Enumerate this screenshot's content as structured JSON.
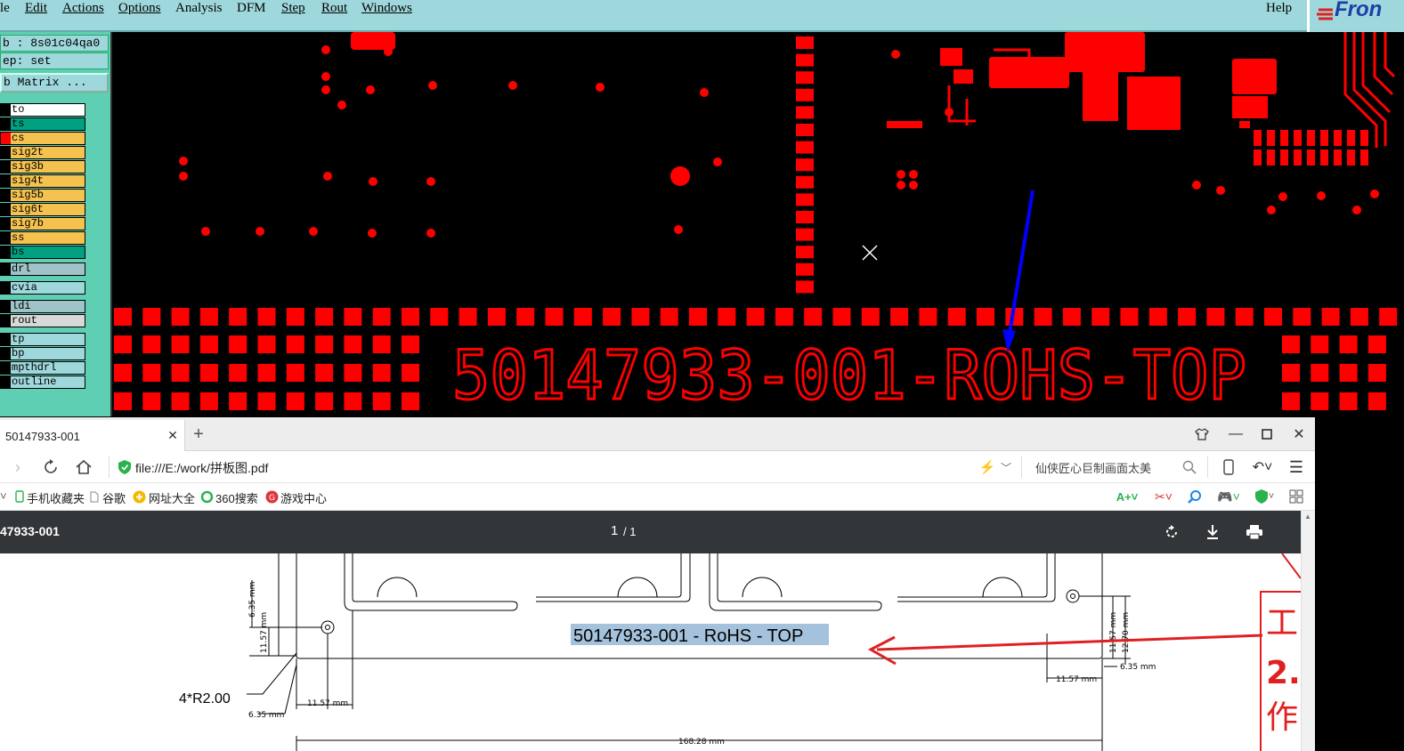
{
  "menu": {
    "items": [
      "le",
      "Edit",
      "Actions",
      "Options",
      "Analysis",
      "DFM",
      "Step",
      "Rout",
      "Windows"
    ],
    "help": "Help",
    "logo": "Fron"
  },
  "info": {
    "job": "b : 8s01c04qa0",
    "step": "ep: set",
    "matrix_button": "b Matrix ..."
  },
  "layers": [
    {
      "name": "to",
      "color": "#ffffff",
      "swatch": "#000000"
    },
    {
      "name": "ts",
      "color": "#00a080",
      "swatch": "#000000"
    },
    {
      "name": "cs",
      "color": "#f5c24f",
      "swatch": "#ff0000"
    },
    {
      "name": "sig2t",
      "color": "#f5c24f",
      "swatch": "#000000"
    },
    {
      "name": "sig3b",
      "color": "#f5c24f",
      "swatch": "#000000"
    },
    {
      "name": "sig4t",
      "color": "#f5c24f",
      "swatch": "#000000"
    },
    {
      "name": "sig5b",
      "color": "#f5c24f",
      "swatch": "#000000"
    },
    {
      "name": "sig6t",
      "color": "#f5c24f",
      "swatch": "#000000"
    },
    {
      "name": "sig7b",
      "color": "#f5c24f",
      "swatch": "#000000"
    },
    {
      "name": "ss",
      "color": "#f5c24f",
      "swatch": "#000000"
    },
    {
      "name": "bs",
      "color": "#00a080",
      "swatch": "#000000"
    },
    {
      "name": "drl",
      "color": "#9fc3c8",
      "swatch": "#000000"
    },
    {
      "name": "cvia",
      "color": "#9fd8dc",
      "swatch": "#000000"
    },
    {
      "name": "ldi",
      "color": "#9fc3c8",
      "swatch": "#000000"
    },
    {
      "name": "rout",
      "color": "#d8d8d8",
      "swatch": "#000000"
    },
    {
      "name": "tp",
      "color": "#9fd8dc",
      "swatch": "#000000"
    },
    {
      "name": "bp",
      "color": "#9fd8dc",
      "swatch": "#000000"
    },
    {
      "name": "mpthdrl",
      "color": "#9fd8dc",
      "swatch": "#000000"
    },
    {
      "name": "outline",
      "color": "#9fd8dc",
      "swatch": "#000000"
    }
  ],
  "canvas": {
    "board_text": "50147933-001-ROHS-TOP",
    "copper_color": "#ff0000",
    "arrow_color": "#0000ff"
  },
  "browser": {
    "tab_title": "50147933-001",
    "address": "file:///E:/work/拼板图.pdf",
    "search_hint": "仙侠匠心巨制画面太美",
    "bookmarks": [
      "手机收藏夹",
      "谷歌",
      "网址大全",
      "360搜索",
      "游戏中心"
    ],
    "pdf_title": "47933-001",
    "page_current": "1",
    "page_total": "/ 1"
  },
  "drawing": {
    "label": "50147933-001 - RoHS - TOP",
    "radius_note": "4*R2.00",
    "dims": {
      "d635_v": "6.35 mm",
      "d1157_v": "11.57 mm",
      "d635_h": "6.35 mm",
      "d1157_h": "11.57 mm",
      "d1157_rv": "11.57 mm",
      "d1270_rv": "12.70 mm",
      "d635_rh": "6.35 mm",
      "d1157_rh": "11.57 mm",
      "d16828": "168.28 mm"
    },
    "side_note": [
      "工",
      "2.",
      "作"
    ]
  }
}
